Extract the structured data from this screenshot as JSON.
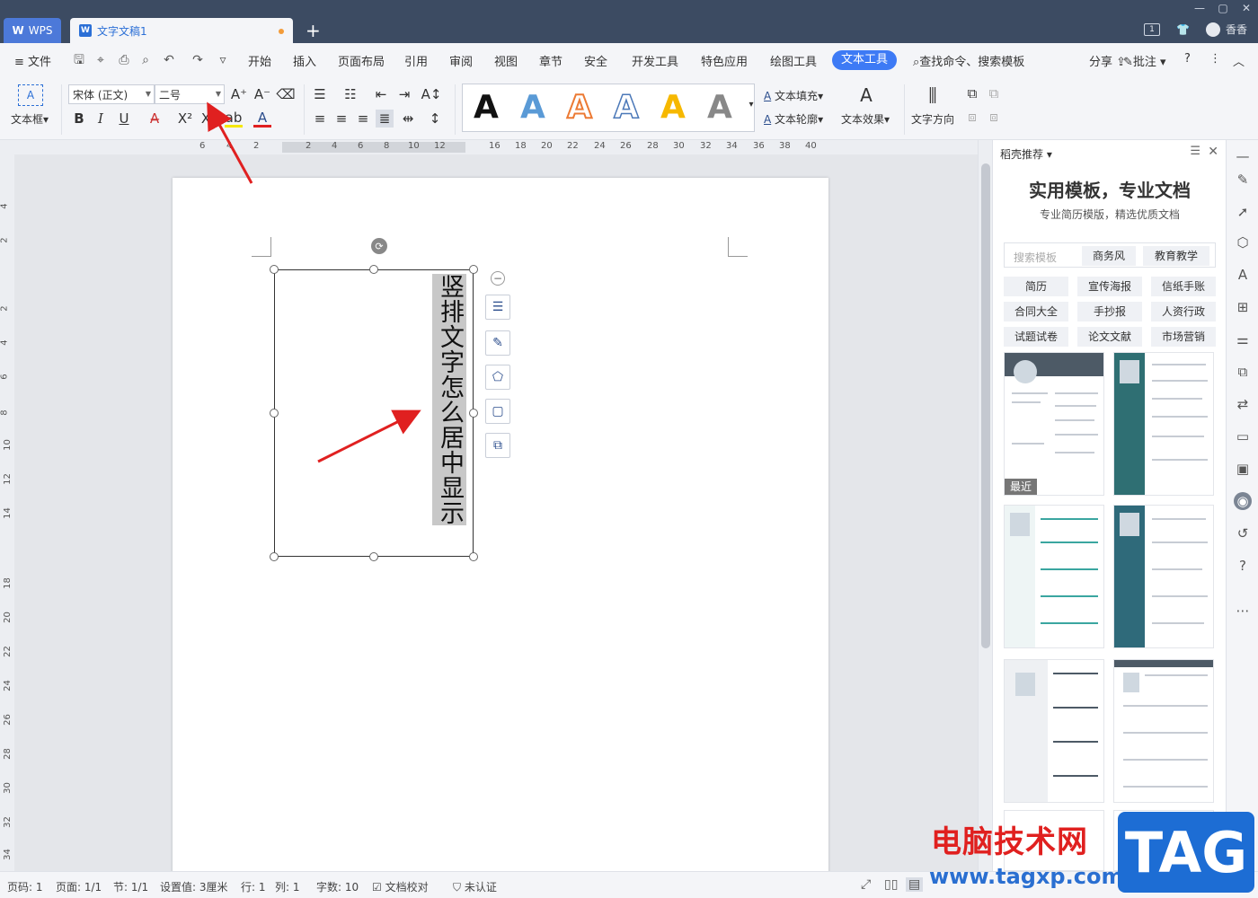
{
  "titlebar": {
    "app_tab": "WPS",
    "doc_tab": "文字文稿1",
    "new_tab": "+",
    "badge": "1",
    "user_name": "香香",
    "controls": [
      "—",
      "▢",
      "✕"
    ]
  },
  "menu": {
    "file": "文件",
    "items": [
      "开始",
      "插入",
      "页面布局",
      "引用",
      "审阅",
      "视图",
      "章节",
      "安全",
      "开发工具",
      "特色应用",
      "绘图工具"
    ],
    "active": "文本工具",
    "search": "查找命令、搜索模板",
    "share": "分享",
    "comment": "批注",
    "help": "?",
    "more": "⋮",
    "collapse": "︿"
  },
  "ribbon": {
    "textbox": "文本框",
    "font_name": "宋体 (正文)",
    "font_size": "二号",
    "bold": "B",
    "italic": "I",
    "underline": "U",
    "text_fill": "文本填充",
    "text_outline": "文本轮廓",
    "text_effect": "文本效果",
    "text_direction": "文字方向",
    "style_letter": "A"
  },
  "ruler": {
    "h_left": [
      "6",
      "4",
      "2"
    ],
    "h_mid": [
      "2",
      "4",
      "6",
      "8",
      "10",
      "12"
    ],
    "h_right": [
      "16",
      "18",
      "20",
      "22",
      "24",
      "26",
      "28",
      "30",
      "32",
      "34",
      "36",
      "38",
      "40"
    ],
    "v": [
      "4",
      "2",
      "2",
      "4",
      "6",
      "8",
      "10",
      "12",
      "14",
      "18",
      "20",
      "22",
      "24",
      "26",
      "28",
      "30",
      "32",
      "34"
    ]
  },
  "document": {
    "vertical_text": "竖排文字怎么居中显示"
  },
  "panel": {
    "header": "稻壳推荐",
    "title": "实用模板，专业文档",
    "subtitle": "专业简历模版，精选优质文档",
    "search_placeholder": "搜索模板",
    "chip1": "商务风",
    "chip2": "教育教学",
    "categories": [
      "简历",
      "宣传海报",
      "信纸手账",
      "合同大全",
      "手抄报",
      "人资行政",
      "试题试卷",
      "论文文献",
      "市场营销"
    ],
    "recent": "最近"
  },
  "status": {
    "page_no": "页码: 1",
    "pages": "页面: 1/1",
    "section": "节: 1/1",
    "setting": "设置值: 3厘米",
    "row": "行: 1",
    "col": "列: 1",
    "words": "字数: 10",
    "proof": "文档校对",
    "cert": "未认证"
  },
  "watermark": {
    "site_name": "电脑技术网",
    "url": "www.tagxp.com",
    "logo": "TAG"
  },
  "colors": {
    "titlebar": "#3c4b62",
    "accent": "#3d7af5",
    "arrow": "#e02020"
  }
}
